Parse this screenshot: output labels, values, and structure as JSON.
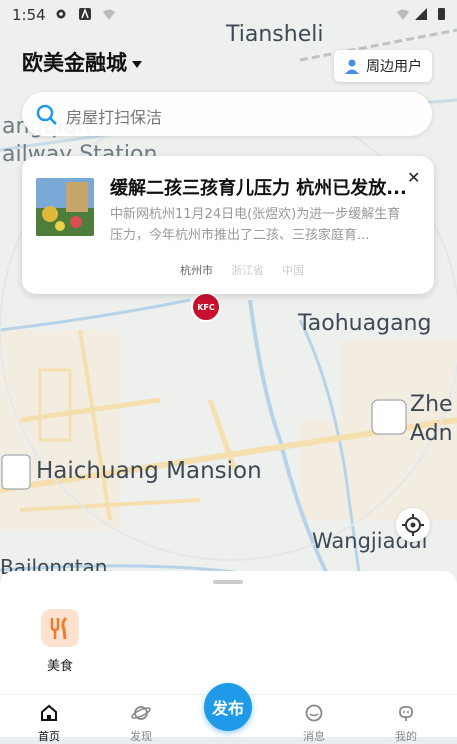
{
  "status_bar": {
    "time": "1:54"
  },
  "header": {
    "city": "欧美金融城",
    "nearby_button": "周边用户"
  },
  "search": {
    "placeholder": "房屋打扫保洁"
  },
  "map": {
    "labels": [
      "Tiansheli",
      "angqian",
      "ailway Station",
      "Taohuagang",
      "Zhe",
      "Adn",
      "Haichuang Mansion",
      "Wangjiadai",
      "Bailongtan"
    ],
    "poi": "KFC"
  },
  "news_card": {
    "title": "缓解二孩三孩育儿压力 杭州已发放...",
    "summary": "中新网杭州11月24日电(张煜欢)为进一步缓解生育压力，今年杭州市推出了二孩、三孩家庭育...",
    "tags": [
      "杭州市",
      "浙江省",
      "中国"
    ]
  },
  "categories": [
    {
      "label": "美食",
      "icon": "food-icon"
    }
  ],
  "tabbar": {
    "tabs": [
      {
        "label": "首页",
        "icon": "home-icon"
      },
      {
        "label": "发现",
        "icon": "planet-icon"
      },
      {
        "label": "消息",
        "icon": "chat-icon"
      },
      {
        "label": "我的",
        "icon": "robot-icon"
      }
    ],
    "publish": "发布"
  },
  "colors": {
    "accent": "#1e9ae8",
    "kfc_red": "#c8102e"
  }
}
